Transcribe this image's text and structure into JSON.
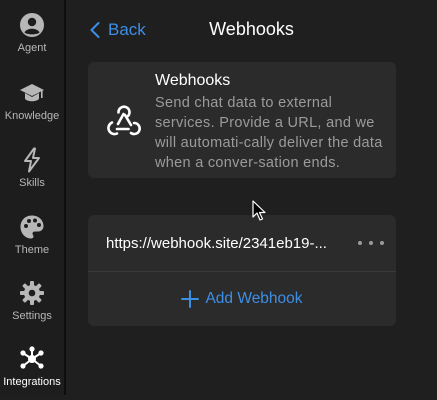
{
  "sidebar": {
    "items": [
      {
        "label": "Agent",
        "icon": "person-icon",
        "active": false
      },
      {
        "label": "Knowledge",
        "icon": "graduation-cap-icon",
        "active": false
      },
      {
        "label": "Skills",
        "icon": "lightning-icon",
        "active": false
      },
      {
        "label": "Theme",
        "icon": "palette-icon",
        "active": false
      },
      {
        "label": "Settings",
        "icon": "gear-icon",
        "active": false
      },
      {
        "label": "Integrations",
        "icon": "network-icon",
        "active": true
      }
    ]
  },
  "header": {
    "back_label": "Back",
    "title": "Webhooks"
  },
  "info_card": {
    "title": "Webhooks",
    "description": "Send chat data to external services. Provide a URL, and we will automati-cally deliver the data when a conver-sation ends.",
    "icon": "webhook-icon"
  },
  "webhooks": {
    "items": [
      {
        "url": "https://webhook.site/2341eb19-..."
      }
    ],
    "add_label": "Add Webhook"
  },
  "colors": {
    "accent": "#3d8fe6",
    "background": "#1f1f1f",
    "card": "#2b2b2b"
  }
}
